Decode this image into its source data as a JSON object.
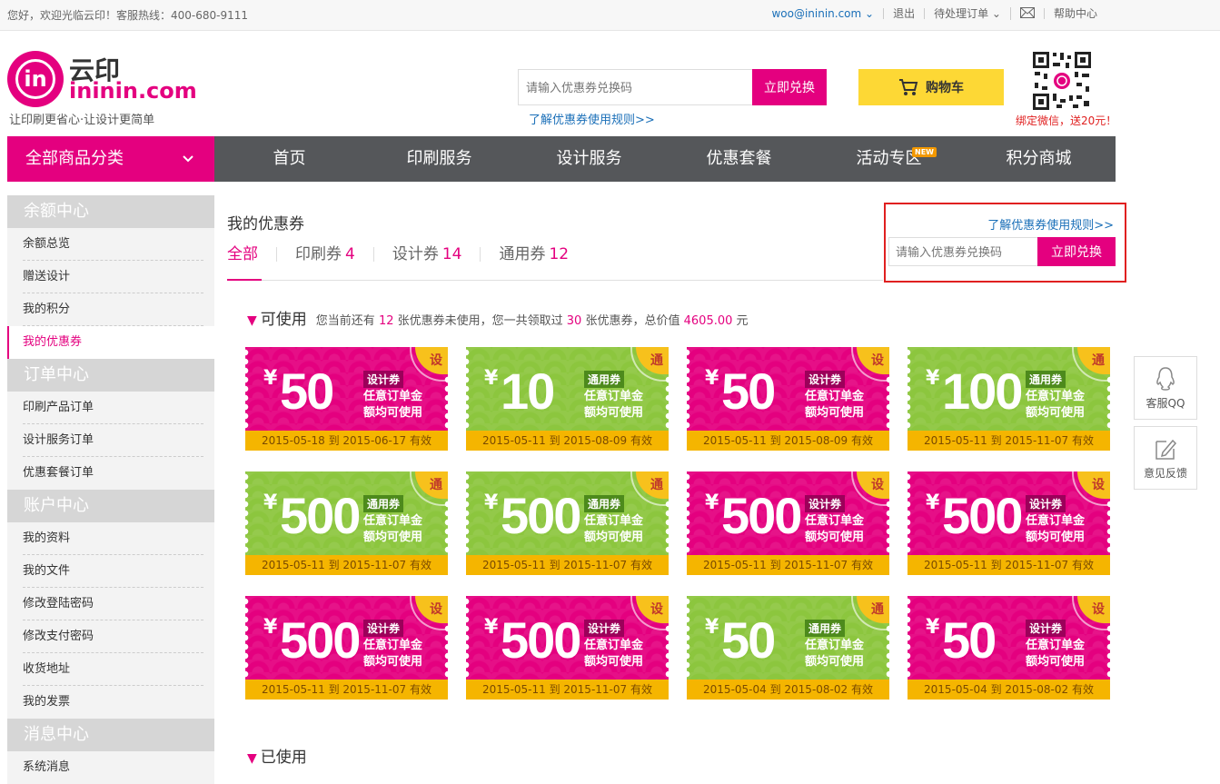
{
  "topbar": {
    "greeting": "您好，欢迎光临云印！客服热线：400-680-9111",
    "email": "woo@ininin.com ⌄",
    "logout": "退出",
    "pending": "待处理订单 ⌄",
    "help": "帮助中心"
  },
  "logo": {
    "cn": "云印",
    "en": "ininin.com",
    "slogan": "让印刷更省心·让设计更简单"
  },
  "header": {
    "search_placeholder": "请输入优惠券兑换码",
    "search_button": "立即兑换",
    "rule_link": "了解优惠券使用规则>>",
    "cart": "购物车",
    "qr_text": "绑定微信，送20元！"
  },
  "nav": {
    "category": "全部商品分类",
    "items": [
      "首页",
      "印刷服务",
      "设计服务",
      "优惠套餐",
      "活动专区",
      "积分商城"
    ],
    "new_badge": "NEW"
  },
  "sidebar": {
    "groups": [
      {
        "title": "余额中心",
        "items": [
          "余额总览",
          "赠送设计",
          "我的积分",
          "我的优惠券"
        ]
      },
      {
        "title": "订单中心",
        "items": [
          "印刷产品订单",
          "设计服务订单",
          "优惠套餐订单"
        ]
      },
      {
        "title": "账户中心",
        "items": [
          "我的资料",
          "我的文件",
          "修改登陆密码",
          "修改支付密码",
          "收货地址",
          "我的发票"
        ]
      },
      {
        "title": "消息中心",
        "items": [
          "系统消息"
        ]
      }
    ]
  },
  "main": {
    "title": "我的优惠券",
    "tabs": [
      {
        "label": "全部",
        "count": ""
      },
      {
        "label": "印刷券",
        "count": "4"
      },
      {
        "label": "设计券",
        "count": "14"
      },
      {
        "label": "通用券",
        "count": "12"
      }
    ],
    "redeem": {
      "rule_link": "了解优惠券使用规则>>",
      "placeholder": "请输入优惠券兑换码",
      "button": "立即兑换"
    },
    "available": {
      "title": "可使用",
      "info_a": "您当前还有",
      "unused": "12",
      "info_b": "张优惠券未使用，您一共领取过",
      "total": "30",
      "info_c": "张优惠券，总价值",
      "value": "4605.00",
      "info_d": "元"
    },
    "used": {
      "title": "已使用"
    },
    "yen": "¥",
    "desc": "任意订单金额均可使用",
    "coupons": [
      {
        "amount": "50",
        "type": "设计券",
        "corner": "设",
        "color": "pink",
        "date": "2015-05-18 到 2015-06-17 有效"
      },
      {
        "amount": "10",
        "type": "通用券",
        "corner": "通",
        "color": "green",
        "date": "2015-05-11 到 2015-08-09 有效"
      },
      {
        "amount": "50",
        "type": "设计券",
        "corner": "设",
        "color": "pink",
        "date": "2015-05-11 到 2015-08-09 有效"
      },
      {
        "amount": "100",
        "type": "通用券",
        "corner": "通",
        "color": "green",
        "date": "2015-05-11 到 2015-11-07 有效"
      },
      {
        "amount": "500",
        "type": "通用券",
        "corner": "通",
        "color": "green",
        "date": "2015-05-11 到 2015-11-07 有效"
      },
      {
        "amount": "500",
        "type": "通用券",
        "corner": "通",
        "color": "green",
        "date": "2015-05-11 到 2015-11-07 有效"
      },
      {
        "amount": "500",
        "type": "设计券",
        "corner": "设",
        "color": "pink",
        "date": "2015-05-11 到 2015-11-07 有效"
      },
      {
        "amount": "500",
        "type": "设计券",
        "corner": "设",
        "color": "pink",
        "date": "2015-05-11 到 2015-11-07 有效"
      },
      {
        "amount": "500",
        "type": "设计券",
        "corner": "设",
        "color": "pink",
        "date": "2015-05-11 到 2015-11-07 有效"
      },
      {
        "amount": "500",
        "type": "设计券",
        "corner": "设",
        "color": "pink",
        "date": "2015-05-11 到 2015-11-07 有效"
      },
      {
        "amount": "50",
        "type": "通用券",
        "corner": "通",
        "color": "green",
        "date": "2015-05-04 到 2015-08-02 有效"
      },
      {
        "amount": "50",
        "type": "设计券",
        "corner": "设",
        "color": "pink",
        "date": "2015-05-04 到 2015-08-02 有效"
      }
    ]
  },
  "float": {
    "qq": "客服QQ",
    "feedback": "意见反馈"
  },
  "colors": {
    "brand": "#e4007f",
    "green": "#8cc63e",
    "nav": "#55575a",
    "date_bar": "#f5b500"
  }
}
